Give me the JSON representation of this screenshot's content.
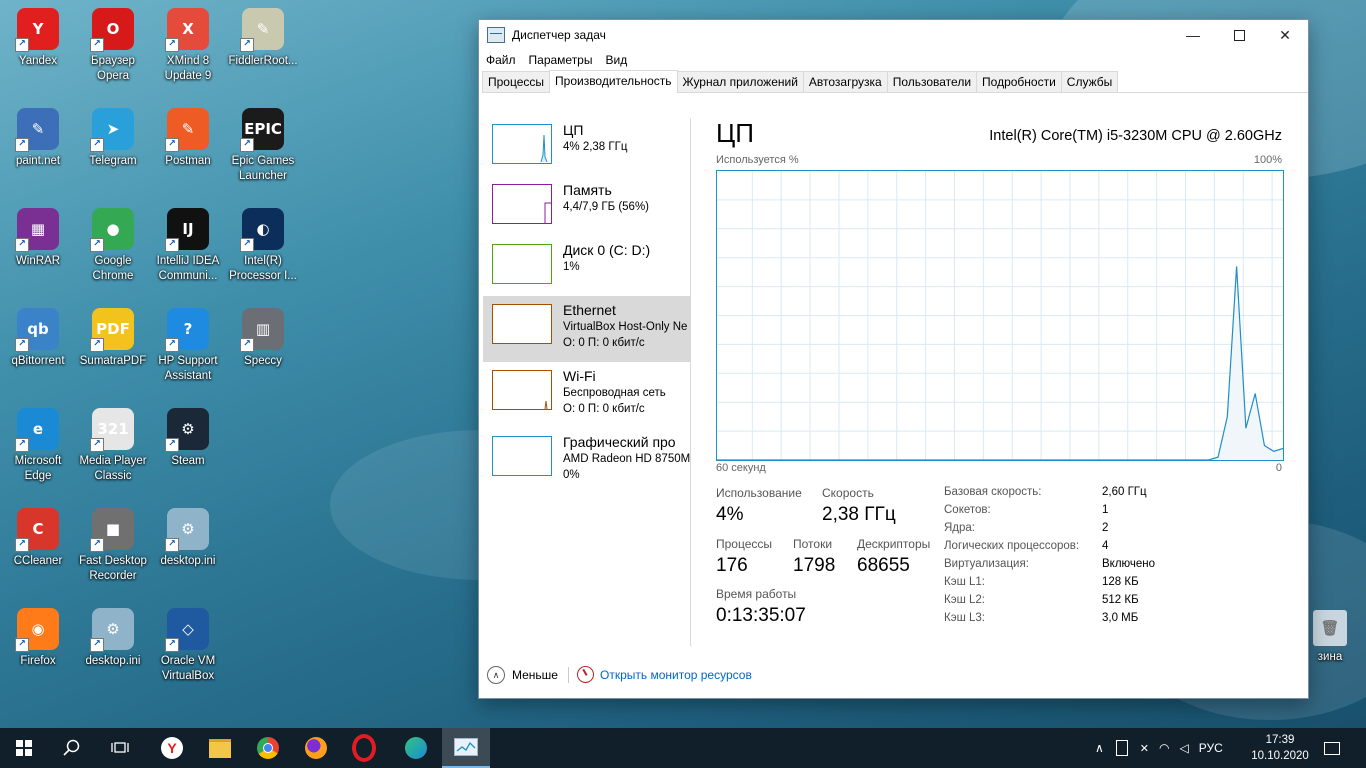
{
  "desktop_icons": [
    {
      "label": "Yandex",
      "color": "#e11f1f",
      "glyph": "Y"
    },
    {
      "label": "Браузер Opera",
      "color": "#d81919",
      "glyph": "O"
    },
    {
      "label": "XMind 8 Update 9",
      "color": "#e54b3a",
      "glyph": "X"
    },
    {
      "label": "FiddlerRoot...",
      "color": "#c9c9b0",
      "glyph": "✎"
    },
    {
      "label": "paint.net",
      "color": "#3d6fb8",
      "glyph": "✎"
    },
    {
      "label": "Telegram",
      "color": "#2aa0da",
      "glyph": "➤"
    },
    {
      "label": "Postman",
      "color": "#ef5b25",
      "glyph": "✎"
    },
    {
      "label": "Epic Games Launcher",
      "color": "#1b1b1b",
      "glyph": "EPIC"
    },
    {
      "label": "WinRAR",
      "color": "#7a2f93",
      "glyph": "▦"
    },
    {
      "label": "Google Chrome",
      "color": "#34a853",
      "glyph": "●"
    },
    {
      "label": "IntelliJ IDEA Communi...",
      "color": "#111111",
      "glyph": "IJ"
    },
    {
      "label": "Intel(R) Processor I...",
      "color": "#0b2e5a",
      "glyph": "◐"
    },
    {
      "label": "qBittorrent",
      "color": "#3a83c9",
      "glyph": "qb"
    },
    {
      "label": "SumatraPDF",
      "color": "#f3c21c",
      "glyph": "PDF"
    },
    {
      "label": "HP Support Assistant",
      "color": "#1e8ae0",
      "glyph": "?"
    },
    {
      "label": "Speccy",
      "color": "#6b6f75",
      "glyph": "▥"
    },
    {
      "label": "Microsoft Edge",
      "color": "#1a8ad4",
      "glyph": "e"
    },
    {
      "label": "Media Player Classic",
      "color": "#e6e6e6",
      "glyph": "321"
    },
    {
      "label": "Steam",
      "color": "#1b2838",
      "glyph": "⚙"
    },
    {
      "label": "CCleaner",
      "color": "#d8362a",
      "glyph": "C"
    },
    {
      "label": "Fast Desktop Recorder",
      "color": "#707070",
      "glyph": "■"
    },
    {
      "label": "desktop.ini",
      "color": "#8fb3c8",
      "glyph": "⚙"
    },
    {
      "label": "Firefox",
      "color": "#ff7a18",
      "glyph": "◉"
    },
    {
      "label": "desktop.ini",
      "color": "#8fb3c8",
      "glyph": "⚙"
    },
    {
      "label": "Oracle VM VirtualBox",
      "color": "#1f5aa0",
      "glyph": "◇"
    }
  ],
  "recycle_label_partial": "зина",
  "window": {
    "title": "Диспетчер задач",
    "menu": [
      "Файл",
      "Параметры",
      "Вид"
    ],
    "tabs": [
      "Процессы",
      "Производительность",
      "Журнал приложений",
      "Автозагрузка",
      "Пользователи",
      "Подробности",
      "Службы"
    ],
    "active_tab": "Производительность"
  },
  "sidebar": [
    {
      "name": "ЦП",
      "line1": "4% 2,38 ГГц",
      "line2": "",
      "color": "#1e8fc7"
    },
    {
      "name": "Память",
      "line1": "4,4/7,9 ГБ (56%)",
      "line2": "",
      "color": "#8b1d9e"
    },
    {
      "name": "Диск 0 (C: D:)",
      "line1": "1%",
      "line2": "",
      "color": "#4da60c"
    },
    {
      "name": "Ethernet",
      "line1": "VirtualBox Host-Only Ne",
      "line2": "О: 0 П: 0 кбит/с",
      "color": "#a74f01"
    },
    {
      "name": "Wi-Fi",
      "line1": "Беспроводная сеть",
      "line2": "О: 0 П: 0 кбит/с",
      "color": "#a74f01"
    },
    {
      "name": "Графический про",
      "line1": "AMD Radeon HD 8750M",
      "line2": "0%",
      "color": "#1e8fc7"
    }
  ],
  "cpu": {
    "title": "ЦП",
    "model": "Intel(R) Core(TM) i5-3230M CPU @ 2.60GHz",
    "graph_label": "Используется %",
    "graph_max": "100%",
    "graph_time": "60 секунд",
    "graph_min": "0",
    "usage_series": [
      0,
      0,
      0,
      0,
      0,
      0,
      0,
      0,
      0,
      0,
      0,
      0,
      0,
      0,
      0,
      0,
      0,
      0,
      0,
      0,
      0,
      0,
      0,
      0,
      0,
      0,
      0,
      0,
      0,
      0,
      0,
      0,
      0,
      0,
      0,
      0,
      0,
      0,
      0,
      0,
      0,
      0,
      0,
      0,
      0,
      0,
      0,
      0,
      0,
      0,
      0,
      0,
      0,
      0,
      1,
      15,
      67,
      11,
      23,
      5,
      3,
      4
    ],
    "stats": {
      "usage_label": "Использование",
      "usage_value": "4%",
      "speed_label": "Скорость",
      "speed_value": "2,38 ГГц",
      "proc_label": "Процессы",
      "proc_value": "176",
      "threads_label": "Потоки",
      "threads_value": "1798",
      "handles_label": "Дескрипторы",
      "handles_value": "68655",
      "uptime_label": "Время работы",
      "uptime_value": "0:13:35:07"
    },
    "details": [
      {
        "k": "Базовая скорость:",
        "v": "2,60 ГГц"
      },
      {
        "k": "Сокетов:",
        "v": "1"
      },
      {
        "k": "Ядра:",
        "v": "2"
      },
      {
        "k": "Логических процессоров:",
        "v": "4"
      },
      {
        "k": "Виртуализация:",
        "v": "Включено"
      },
      {
        "k": "Кэш L1:",
        "v": "128 КБ"
      },
      {
        "k": "Кэш L2:",
        "v": "512 КБ"
      },
      {
        "k": "Кэш L3:",
        "v": "3,0 МБ"
      }
    ]
  },
  "footer": {
    "less": "Меньше",
    "monitor": "Открыть монитор ресурсов"
  },
  "taskbar": {
    "lang": "РУС",
    "time": "17:39",
    "date": "10.10.2020"
  }
}
